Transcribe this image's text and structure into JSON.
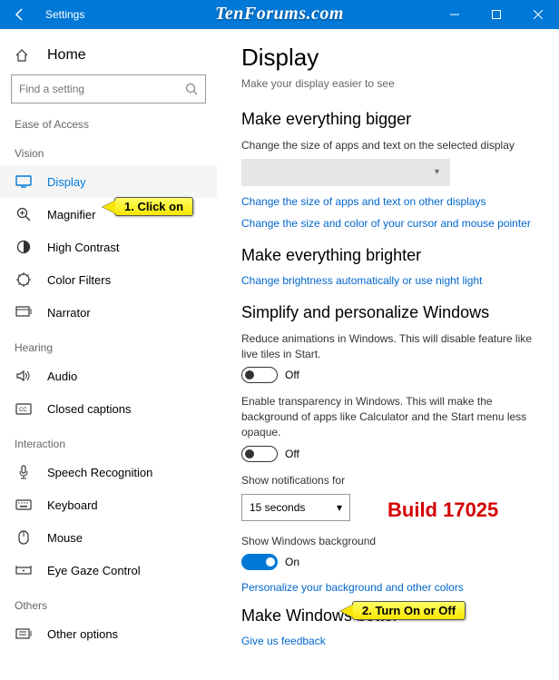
{
  "window": {
    "app": "Settings"
  },
  "watermark": "TenForums.com",
  "sidebar": {
    "home": "Home",
    "search_placeholder": "Find a setting",
    "category": "Ease of Access",
    "groups": {
      "vision": "Vision",
      "hearing": "Hearing",
      "interaction": "Interaction",
      "others": "Others"
    },
    "items": {
      "display": "Display",
      "magnifier": "Magnifier",
      "high_contrast": "High Contrast",
      "color_filters": "Color Filters",
      "narrator": "Narrator",
      "audio": "Audio",
      "closed_captions": "Closed captions",
      "speech": "Speech Recognition",
      "keyboard": "Keyboard",
      "mouse": "Mouse",
      "eye_gaze": "Eye Gaze Control",
      "other": "Other options"
    }
  },
  "main": {
    "title": "Display",
    "subtitle": "Make your display easier to see",
    "s1": {
      "heading": "Make everything bigger",
      "desc": "Change the size of apps and text on the selected display",
      "link1": "Change the size of apps and text on other displays",
      "link2": "Change the size and color of your cursor and mouse pointer"
    },
    "s2": {
      "heading": "Make everything brighter",
      "link": "Change brightness automatically or use night light"
    },
    "s3": {
      "heading": "Simplify and personalize Windows",
      "anim_desc": "Reduce animations in Windows.  This will disable feature like live tiles in Start.",
      "anim_state": "Off",
      "trans_desc": "Enable transparency in Windows.  This will make the background of apps like Calculator and the Start menu less opaque.",
      "trans_state": "Off",
      "notif_label": "Show notifications for",
      "notif_value": "15 seconds",
      "bg_label": "Show Windows background",
      "bg_state": "On",
      "bg_link": "Personalize your background and other colors"
    },
    "s4": {
      "heading": "Make Windows better",
      "link": "Give us feedback"
    }
  },
  "annotations": {
    "callout1": "1. Click on",
    "callout2": "2. Turn On or Off",
    "build": "Build 17025"
  }
}
